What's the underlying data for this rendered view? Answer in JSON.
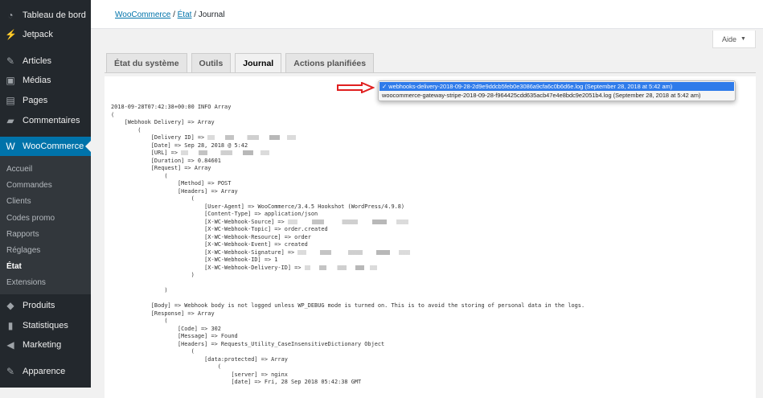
{
  "sidebar": {
    "items": [
      {
        "label": "Tableau de bord",
        "icon": "dashboard-icon",
        "glyph": "◔"
      },
      {
        "label": "Jetpack",
        "icon": "jetpack-icon",
        "glyph": "⚡"
      },
      {
        "label": "Articles",
        "icon": "pin-icon",
        "glyph": "✎"
      },
      {
        "label": "Médias",
        "icon": "media-icon",
        "glyph": "▣"
      },
      {
        "label": "Pages",
        "icon": "pages-icon",
        "glyph": "▤"
      },
      {
        "label": "Commentaires",
        "icon": "comments-icon",
        "glyph": "▰"
      },
      {
        "label": "WooCommerce",
        "icon": "woo-icon",
        "glyph": "W"
      },
      {
        "label": "Produits",
        "icon": "products-icon",
        "glyph": "◆"
      },
      {
        "label": "Statistiques",
        "icon": "stats-icon",
        "glyph": "▮"
      },
      {
        "label": "Marketing",
        "icon": "megaphone-icon",
        "glyph": "◀"
      },
      {
        "label": "Apparence",
        "icon": "brush-icon",
        "glyph": "✎"
      }
    ],
    "submenu": [
      "Accueil",
      "Commandes",
      "Clients",
      "Codes promo",
      "Rapports",
      "Réglages",
      "État",
      "Extensions"
    ]
  },
  "breadcrumb": {
    "a": "WooCommerce",
    "b": "État",
    "c": "Journal",
    "sep": "/"
  },
  "help": {
    "label": "Aide",
    "caret": "▼"
  },
  "tabs": [
    "État du système",
    "Outils",
    "Journal",
    "Actions planifiées"
  ],
  "log_select": {
    "options": [
      "✓ webhooks-delivery-2018-09-28-2d9e9ddcb5feb0e3086a9cfa6c0b6d6e.log (September 28, 2018 at 5:42 am)",
      "woocommerce-gateway-stripe-2018-09-28-f964425cdd635acb47e4e8bdc9e2051b4.log (September 28, 2018 at 5:42 am)"
    ]
  },
  "accent": "#0073aa",
  "log_lines": [
    {
      "t": "2018-09-28T07:42:38+00:00 INFO Array"
    },
    {
      "t": "("
    },
    {
      "t": "    [Webhook Delivery] => Array"
    },
    {
      "t": "        ("
    },
    {
      "t": "            [Delivery ID] => ",
      "r": 1
    },
    {
      "t": "            [Date] => Sep 28, 2018 @ 5:42"
    },
    {
      "t": "            [URL] => ",
      "r": 1
    },
    {
      "t": "            [Duration] => 0.84601"
    },
    {
      "t": "            [Request] => Array"
    },
    {
      "t": "                ("
    },
    {
      "t": "                    [Method] => POST"
    },
    {
      "t": "                    [Headers] => Array"
    },
    {
      "t": "                        ("
    },
    {
      "t": "                            [User-Agent] => WooCommerce/3.4.5 Hookshot (WordPress/4.9.8)"
    },
    {
      "t": "                            [Content-Type] => application/json"
    },
    {
      "t": "                            [X-WC-Webhook-Source] => ",
      "r": 1
    },
    {
      "t": "                            [X-WC-Webhook-Topic] => order.created"
    },
    {
      "t": "                            [X-WC-Webhook-Resource] => order"
    },
    {
      "t": "                            [X-WC-Webhook-Event] => created"
    },
    {
      "t": "                            [X-WC-Webhook-Signature] => ",
      "r": 1
    },
    {
      "t": "                            [X-WC-Webhook-ID] => 1"
    },
    {
      "t": "                            [X-WC-Webhook-Delivery-ID] => ",
      "r": 1
    },
    {
      "t": "                        )"
    },
    {
      "t": ""
    },
    {
      "t": "                )"
    },
    {
      "t": ""
    },
    {
      "t": "            [Body] => Webhook body is not logged unless WP_DEBUG mode is turned on. This is to avoid the storing of personal data in the logs."
    },
    {
      "t": "            [Response] => Array"
    },
    {
      "t": "                ("
    },
    {
      "t": "                    [Code] => 302"
    },
    {
      "t": "                    [Message] => Found"
    },
    {
      "t": "                    [Headers] => Requests_Utility_CaseInsensitiveDictionary Object"
    },
    {
      "t": "                        ("
    },
    {
      "t": "                            [data:protected] => Array"
    },
    {
      "t": "                                ("
    },
    {
      "t": "                                    [server] => nginx"
    },
    {
      "t": "                                    [date] => Fri, 28 Sep 2018 05:42:38 GMT"
    }
  ]
}
